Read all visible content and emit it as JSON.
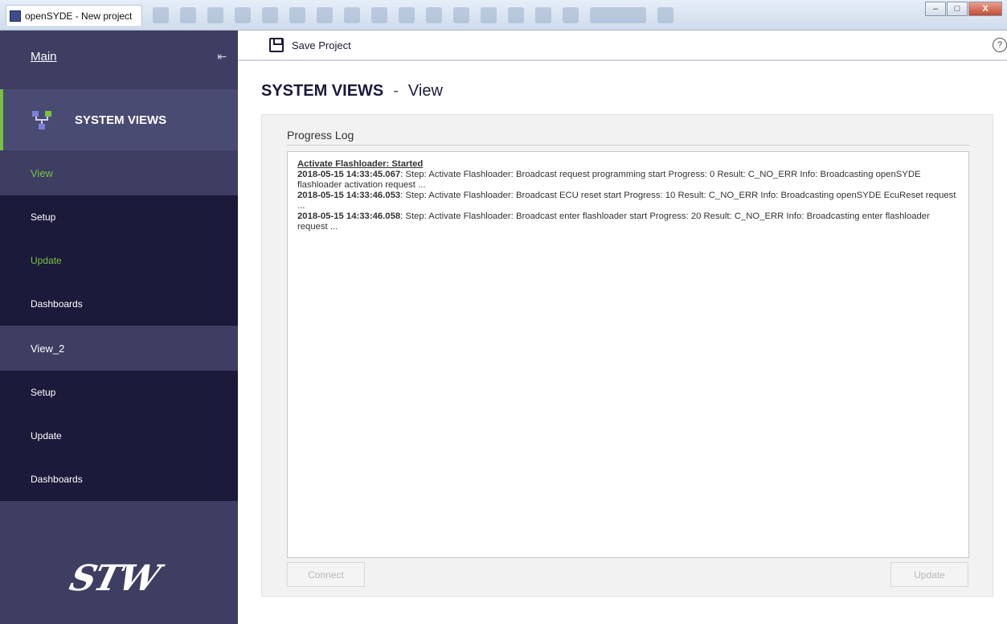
{
  "window": {
    "title": "openSYDE - New project",
    "controls": [
      "–",
      "□",
      "X"
    ]
  },
  "sidebar": {
    "main_label": "Main",
    "exit_icon": "exit-icon",
    "section_title": "SYSTEM VIEWS",
    "section_icon": "network-icon",
    "views": [
      {
        "label": "View",
        "items": [
          "Setup",
          "Update",
          "Dashboards"
        ]
      },
      {
        "label": "View_2",
        "items": [
          "Setup",
          "Update",
          "Dashboards"
        ]
      }
    ],
    "logo_text": "STW"
  },
  "toolbar": {
    "save_label": "Save Project",
    "help_label": "?"
  },
  "page": {
    "title": "SYSTEM VIEWS",
    "separator": "-",
    "subtitle": "View"
  },
  "panel": {
    "title": "Progress Log",
    "log": {
      "header": "Activate Flashloader: Started",
      "entries": [
        {
          "ts": "2018-05-15 14:33:45.067",
          "text": ": Step: Activate Flashloader: Broadcast request programming start Progress: 0 Result: C_NO_ERR Info: Broadcasting openSYDE flashloader activation request ..."
        },
        {
          "ts": "2018-05-15 14:33:46.053",
          "text": ": Step: Activate Flashloader: Broadcast ECU reset start Progress: 10 Result: C_NO_ERR Info: Broadcasting openSYDE EcuReset request ..."
        },
        {
          "ts": "2018-05-15 14:33:46.058",
          "text": ": Step: Activate Flashloader: Broadcast enter flashloader start Progress: 20 Result: C_NO_ERR Info: Broadcasting enter flashloader request ..."
        }
      ]
    },
    "connect_label": "Connect",
    "update_label": "Update"
  },
  "colors": {
    "sidebar_bg": "#3d3e62",
    "sidebar_sub_bg": "#1b1a3a",
    "accent_green": "#7ac143"
  }
}
